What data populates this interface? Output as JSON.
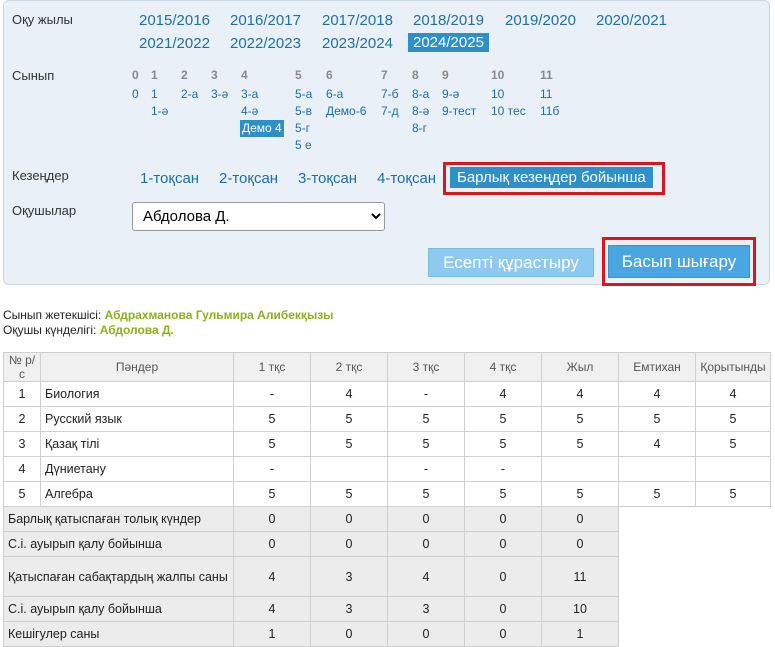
{
  "labels": {
    "year": "Оқу жылы",
    "class": "Сынып",
    "periods": "Кезеңдер",
    "students": "Оқушылар"
  },
  "years": [
    "2015/2016",
    "2016/2017",
    "2017/2018",
    "2018/2019",
    "2019/2020",
    "2020/2021",
    "2021/2022",
    "2022/2023",
    "2023/2024",
    "2024/2025"
  ],
  "selected_year": "2024/2025",
  "class_grades": [
    "0",
    "1",
    "2",
    "3",
    "4",
    "5",
    "6",
    "7",
    "8",
    "9",
    "10",
    "11"
  ],
  "classes": {
    "g0": [
      "0"
    ],
    "g1": [
      "1",
      "1-ә"
    ],
    "g2": [
      "2-а"
    ],
    "g3": [
      "3-ә"
    ],
    "g4": [
      "3-а",
      "4-ә",
      "Демо 4"
    ],
    "g5": [
      "5-а",
      "5-в",
      "5-г",
      "5 е"
    ],
    "g6": [
      "6-а",
      "Демо-6"
    ],
    "g7": [
      "7-б",
      "7-д"
    ],
    "g8": [
      "8-а",
      "8-ә",
      "8-г"
    ],
    "g9": [
      "9-ә",
      "9-тест"
    ],
    "g10": [
      "10",
      "10 тес"
    ],
    "g11": [
      "11",
      "11б"
    ]
  },
  "selected_class": "Демо 4",
  "periods": [
    "1-тоқсан",
    "2-тоқсан",
    "3-тоқсан",
    "4-тоқсан",
    "Барлық кезеңдер бойынша"
  ],
  "student_select": {
    "value": "Абдолова Д.",
    "options": [
      "Абдолова Д."
    ]
  },
  "buttons": {
    "build": "Есепті құрастыру",
    "print": "Басып шығару"
  },
  "info": {
    "teacher_label": "Сынып жетекшісі:",
    "teacher": "Абдрахманова Гульмира Алибекқызы",
    "diary_label": "Оқушы күнделігі:",
    "student": "Абдолова Д."
  },
  "table": {
    "headers": [
      "№ р/с",
      "Пәндер",
      "1 тқс",
      "2 тқс",
      "3 тқс",
      "4 тқс",
      "Жыл",
      "Емтихан",
      "Қорытынды"
    ],
    "rows": [
      [
        "1",
        "Биология",
        "-",
        "4",
        "-",
        "4",
        "4",
        "4",
        "4"
      ],
      [
        "2",
        "Русский язык",
        "5",
        "5",
        "5",
        "5",
        "5",
        "5",
        "5"
      ],
      [
        "3",
        "Қазақ тілі",
        "5",
        "5",
        "5",
        "5",
        "5",
        "4",
        "5"
      ],
      [
        "4",
        "Дүниетану",
        "-",
        "",
        "-",
        "-",
        "",
        "",
        ""
      ],
      [
        "5",
        "Алгебра",
        "5",
        "5",
        "5",
        "5",
        "5",
        "5",
        "5"
      ]
    ],
    "summary": [
      [
        "Барлық қатыспаған толық күндер",
        "0",
        "0",
        "0",
        "0",
        "0"
      ],
      [
        "С.і. ауырып қалу бойынша",
        "0",
        "0",
        "0",
        "0",
        "0"
      ],
      [
        "Қатыспаған сабақтардың жалпы саны",
        "4",
        "3",
        "4",
        "0",
        "11"
      ],
      [
        "С.і. ауырып қалу бойынша",
        "4",
        "3",
        "3",
        "0",
        "10"
      ],
      [
        "Кешігулер саны",
        "1",
        "0",
        "0",
        "0",
        "1"
      ]
    ]
  }
}
